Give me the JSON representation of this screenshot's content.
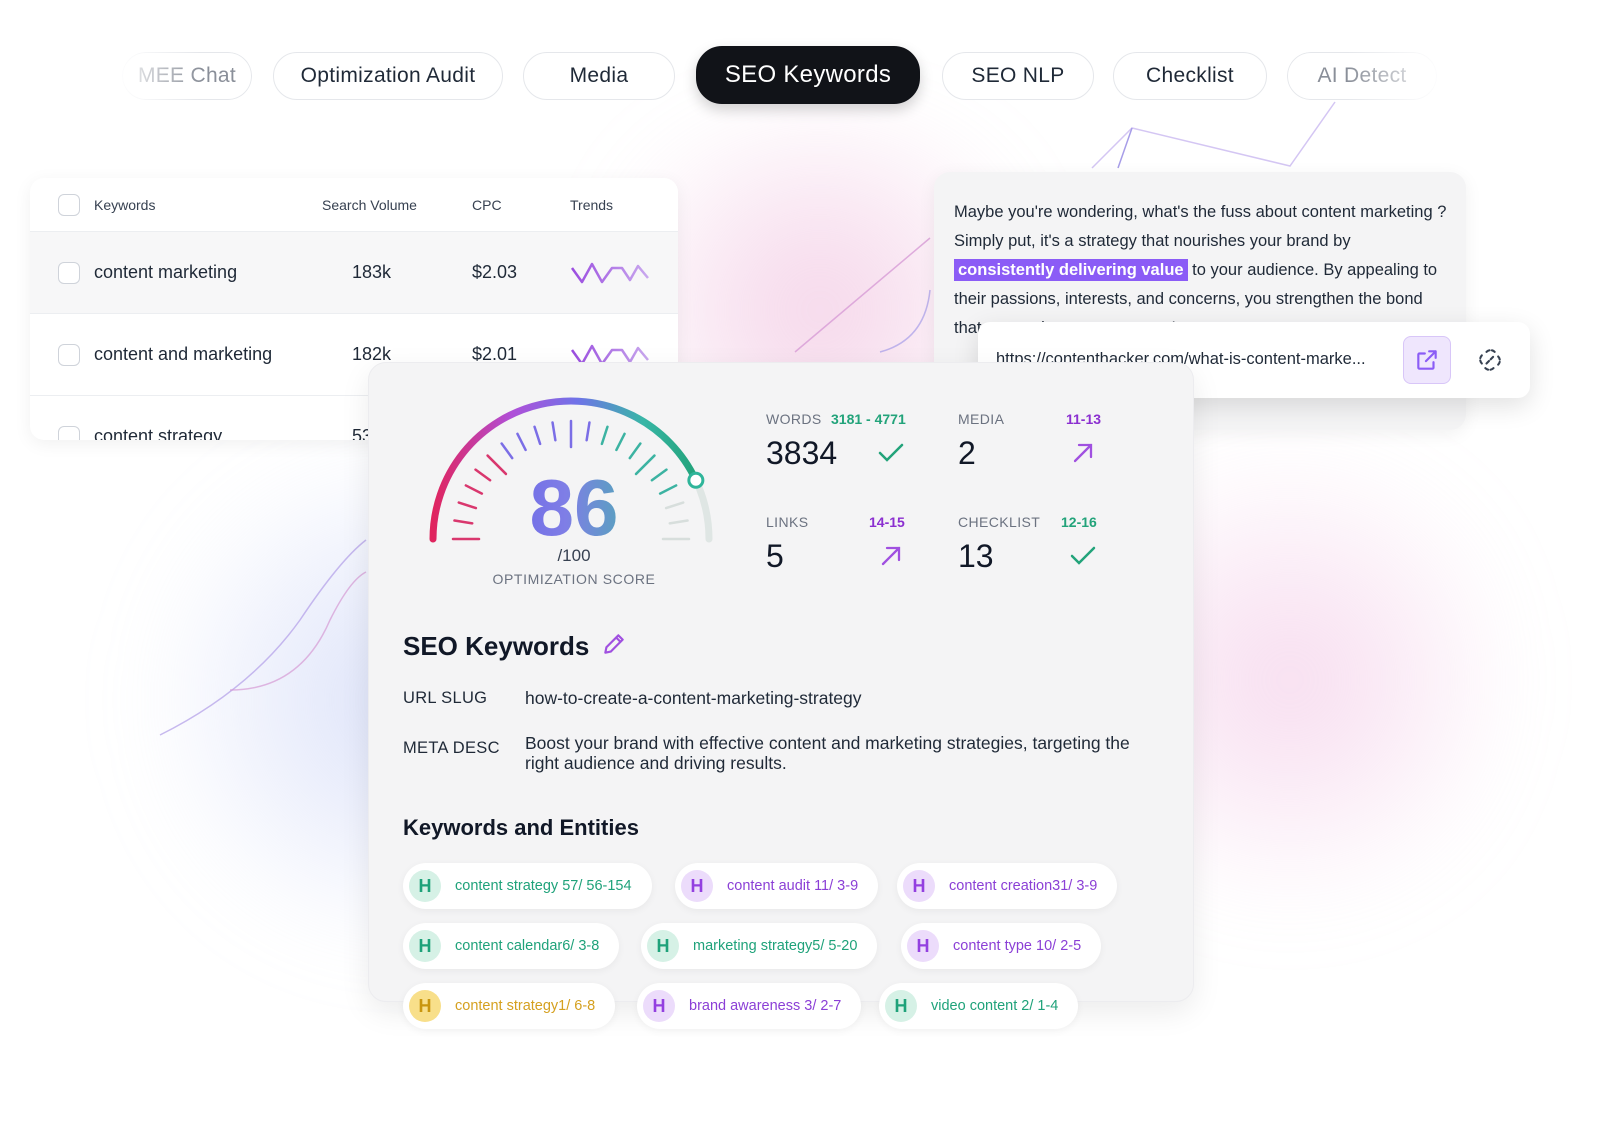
{
  "tabs": [
    {
      "label": "MEE Chat"
    },
    {
      "label": "Optimization Audit"
    },
    {
      "label": "Media"
    },
    {
      "label": "SEO Keywords"
    },
    {
      "label": "SEO NLP"
    },
    {
      "label": "Checklist"
    },
    {
      "label": "AI Detect"
    }
  ],
  "active_tab": "SEO Keywords",
  "keywords_table": {
    "headers": {
      "keyword": "Keywords",
      "volume": "Search Volume",
      "cpc": "CPC",
      "trends": "Trends"
    },
    "rows": [
      {
        "keyword": "content marketing",
        "volume": "183k",
        "cpc": "$2.03"
      },
      {
        "keyword": "content and marketing",
        "volume": "182k",
        "cpc": "$2.01"
      },
      {
        "keyword": "content strategy",
        "volume": "53"
      }
    ]
  },
  "editor": {
    "before": "Maybe you're wondering, what's the fuss about content marketing ? Simply put, it's a strategy that nourishes your brand by ",
    "highlight": "consistently delivering value",
    "after": " to your audience. By appealing to their passions, interests, and concerns, you strengthen the bond that you and your customers. In essence, content ma"
  },
  "link_popup": {
    "url": "https://contenthacker.com/what-is-content-marke..."
  },
  "score": {
    "value": 86,
    "value_text": "86",
    "max_text": "/100",
    "label": "OPTIMIZATION SCORE"
  },
  "metrics": {
    "words": {
      "label": "WORDS",
      "range": "3181 - 4771",
      "value": "3834",
      "status": "check-icon"
    },
    "media": {
      "label": "MEDIA",
      "range": "11-13",
      "value": "2",
      "status": "arrow-up-right-icon"
    },
    "links": {
      "label": "LINKS",
      "range": "14-15",
      "value": "5",
      "status": "arrow-up-right-icon"
    },
    "checklist": {
      "label": "CHECKLIST",
      "range": "12-16",
      "value": "13",
      "status": "check-icon"
    }
  },
  "seo": {
    "title": "SEO Keywords",
    "url_slug_label": "URL SLUG",
    "url_slug": "how-to-create-a-content-marketing-strategy",
    "meta_desc_label": "META DESC",
    "meta_desc": "Boost your brand with effective content and marketing strategies, targeting the right audience and driving results."
  },
  "entities": {
    "title": "Keywords and Entities",
    "badge_letter": "H",
    "chips": [
      {
        "text": "content strategy 57/ 56-154",
        "color": "green"
      },
      {
        "text": "content audit 11/ 3-9",
        "color": "purple"
      },
      {
        "text": "content creation31/ 3-9",
        "color": "purple"
      },
      {
        "text": "content calendar6/ 3-8",
        "color": "green"
      },
      {
        "text": "marketing strategy5/ 5-20",
        "color": "green"
      },
      {
        "text": "content type 10/ 2-5",
        "color": "purple"
      },
      {
        "text": "content strategy1/ 6-8",
        "color": "yellow"
      },
      {
        "text": "brand awareness 3/ 2-7",
        "color": "purple"
      },
      {
        "text": "video content 2/ 1-4",
        "color": "green"
      }
    ]
  },
  "colors": {
    "active_tab_bg": "#111318",
    "highlight": "#8b5cf6",
    "good": "#22a37a",
    "warn": "#8b2fd0"
  }
}
